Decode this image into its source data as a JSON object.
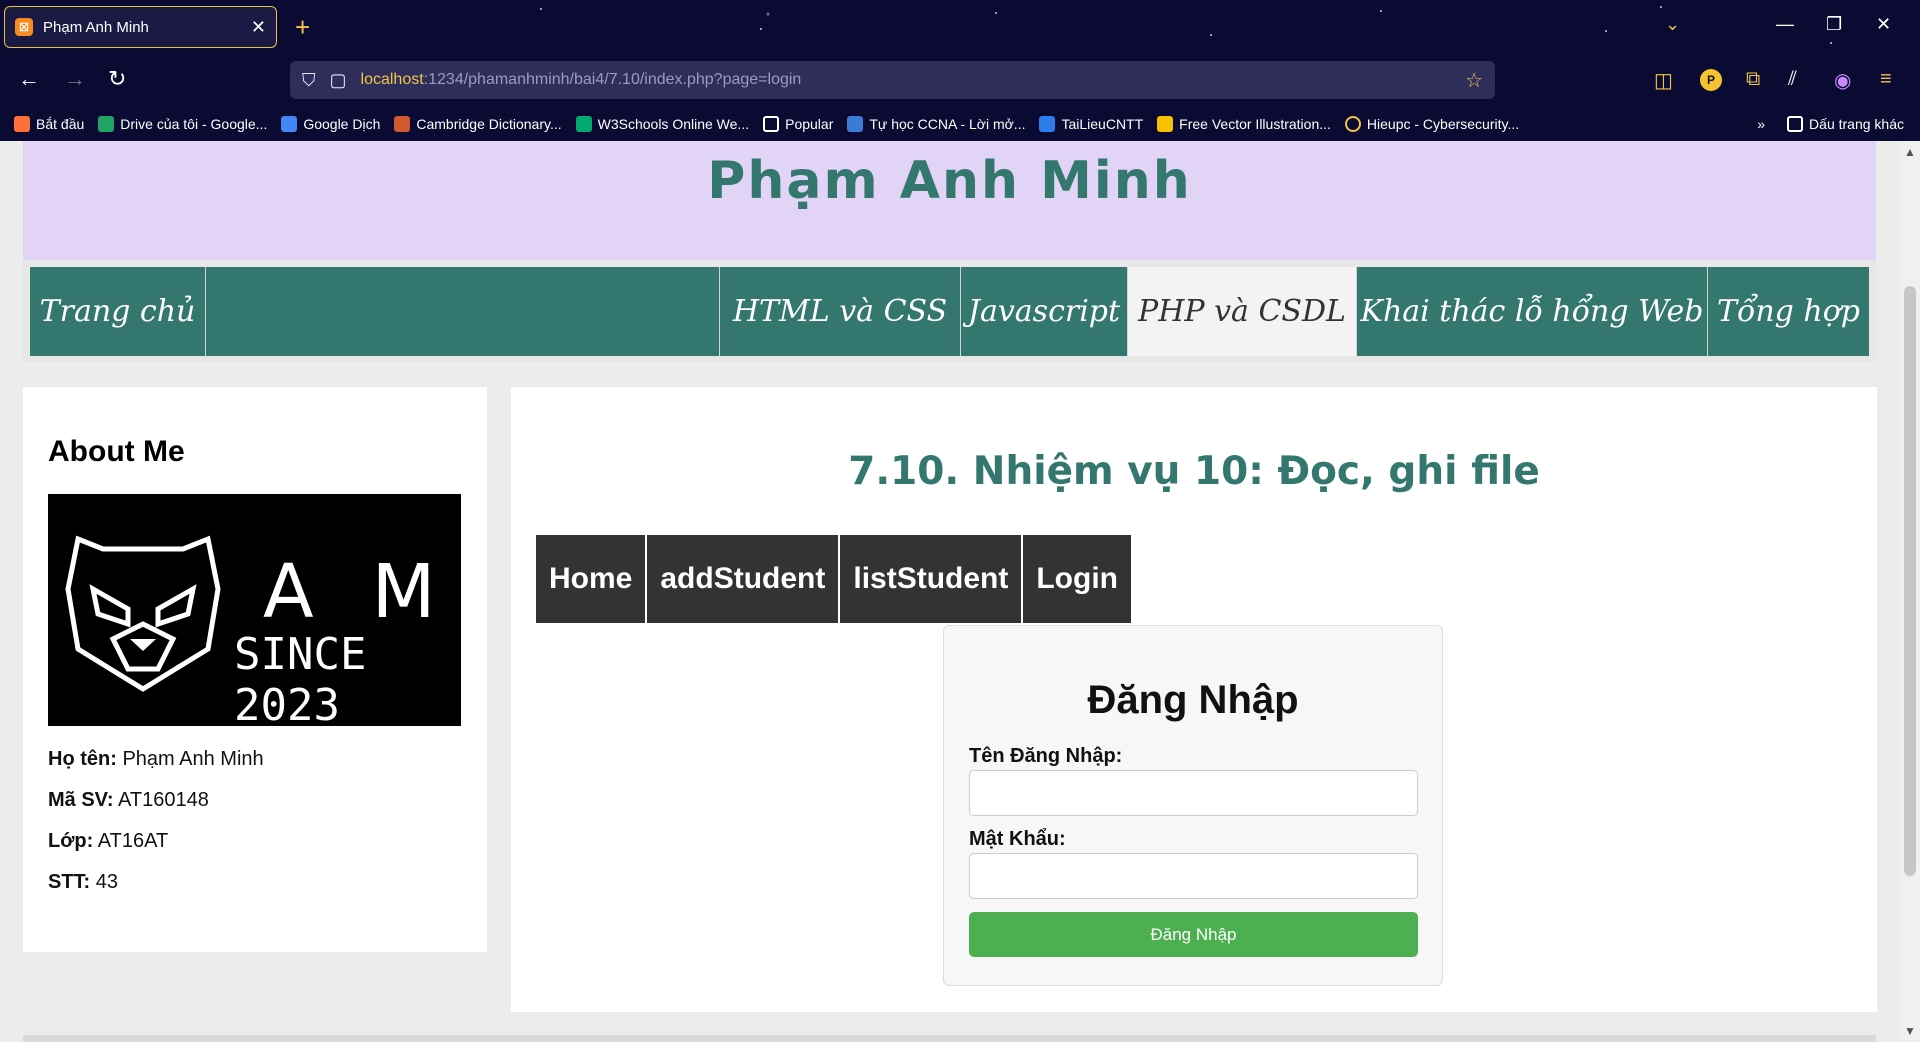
{
  "browser": {
    "tab_title": "Phạm Anh Minh",
    "tab_favicon": "xampp-icon",
    "url_host": "localhost",
    "url_rest": ":1234/phamanhminh/bai4/7.10/index.php?page=login",
    "profile_letter": "P",
    "bookmarks": [
      {
        "label": "Bắt đầu",
        "icon": "firefox-icon",
        "color": "#ff7139"
      },
      {
        "label": "Drive của tôi - Google...",
        "icon": "google-drive-icon",
        "color": "#1fa463"
      },
      {
        "label": "Google Dịch",
        "icon": "google-translate-icon",
        "color": "#4285f4"
      },
      {
        "label": "Cambridge Dictionary...",
        "icon": "cambridge-icon",
        "color": "#d05a2d"
      },
      {
        "label": "W3Schools Online We...",
        "icon": "w3schools-icon",
        "color": "#04aa6d"
      },
      {
        "label": "Popular",
        "icon": "folder-icon",
        "color": "#ffffff"
      },
      {
        "label": "Tự học CCNA - Lời mở...",
        "icon": "ccna-icon",
        "color": "#3a7bd5"
      },
      {
        "label": "TaiLieuCNTT",
        "icon": "tailieucntt-icon",
        "color": "#2b7de9"
      },
      {
        "label": "Free Vector Illustration...",
        "icon": "illustration-icon",
        "color": "#f6c100"
      },
      {
        "label": "Hieupc - Cybersecurity...",
        "icon": "globe-icon",
        "color": "#f0c545"
      }
    ],
    "other_bookmarks": "Dấu trang khác"
  },
  "site": {
    "title": "Phạm Anh Minh",
    "nav": [
      {
        "label": "Trang chủ",
        "active": false
      },
      {
        "label": "HTML và CSS",
        "active": false
      },
      {
        "label": "Javascript",
        "active": false
      },
      {
        "label": "PHP và CSDL",
        "active": true
      },
      {
        "label": "Khai thác lỗ hổng Web",
        "active": false
      },
      {
        "label": "Tổng hợp",
        "active": false
      }
    ],
    "accent": "#33776f",
    "header_bg": "#e1d4f7"
  },
  "aside": {
    "heading": "About Me",
    "logo_letters": "AM",
    "logo_since": "SINCE 2023",
    "name_label": "Họ tên:",
    "name_value": "Phạm Anh Minh",
    "id_label": "Mã SV:",
    "id_value": "AT160148",
    "class_label": "Lớp:",
    "class_value": "AT16AT",
    "stt_label": "STT:",
    "stt_value": "43"
  },
  "main": {
    "heading": "7.10. Nhiệm vụ 10: Đọc, ghi file",
    "subnav": [
      "Home",
      "addStudent",
      "listStudent",
      "Login"
    ],
    "login": {
      "title": "Đăng Nhập",
      "username_label": "Tên Đăng Nhập:",
      "username_value": "",
      "password_label": "Mật Khẩu:",
      "password_value": "",
      "submit_label": "Đăng Nhập",
      "submit_color": "#4caf50"
    }
  }
}
